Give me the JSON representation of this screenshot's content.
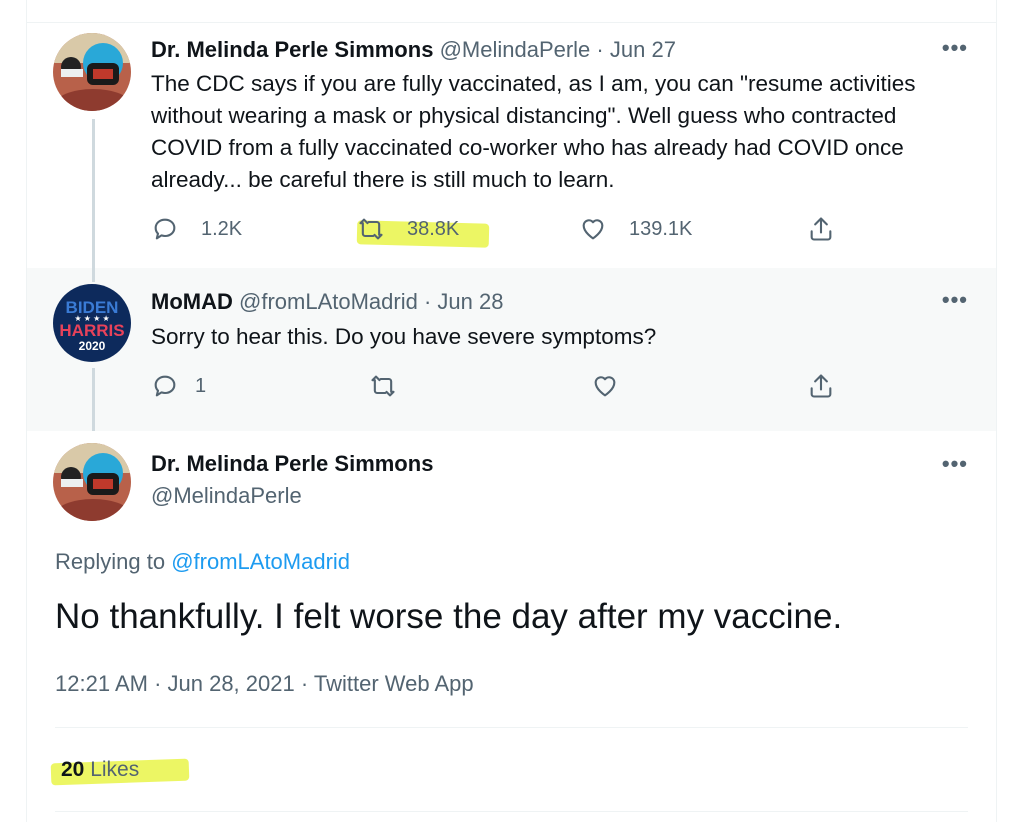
{
  "tweet1": {
    "name": "Dr. Melinda Perle Simmons",
    "handle": "@MelindaPerle",
    "date": "Jun 27",
    "more": "•••",
    "text": "The CDC says if you are fully vaccinated, as I am, you can \"resume activities without wearing a mask or physical distancing\". Well guess who contracted COVID from a fully vaccinated co-worker who has already had COVID once already... be careful there is still much to learn.",
    "replies": "1.2K",
    "retweets": "38.8K",
    "likes": "139.1K",
    "icons": [
      "reply-icon",
      "retweet-icon",
      "like-icon",
      "share-icon"
    ]
  },
  "tweet2": {
    "name": "MoMAD",
    "handle": "@fromLAtoMadrid",
    "date": "Jun 28",
    "more": "•••",
    "text": "Sorry to hear this. Do you have severe symptoms?",
    "replies": "1",
    "avatar_text": {
      "line1": "BIDEN",
      "line2": "HARRIS",
      "year": "2020"
    }
  },
  "main": {
    "name": "Dr. Melinda Perle Simmons",
    "handle": "@MelindaPerle",
    "more": "•••",
    "replying_prefix": "Replying to",
    "replying_to": "@fromLAtoMadrid",
    "text": "No thankfully. I felt worse the day after my vaccine.",
    "timestamp": "12:21 AM · Jun 28, 2021 · Twitter Web App",
    "likes_count": "20",
    "likes_label": "Likes"
  },
  "colors": {
    "text": "#0f1419",
    "muted": "#536471",
    "link": "#1d9bf0",
    "highlight": "#e9f549",
    "reply_bg": "#f7f9f9"
  }
}
